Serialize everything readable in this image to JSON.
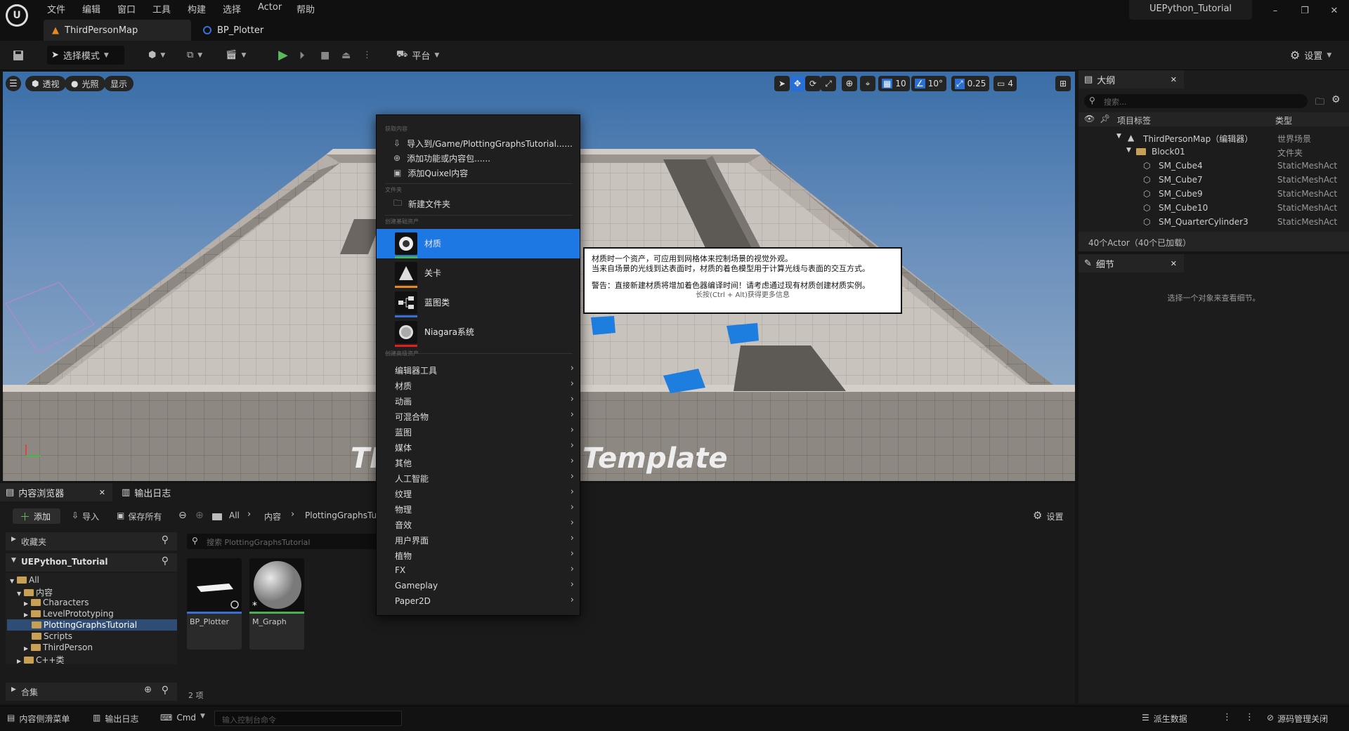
{
  "menubar": {
    "items": [
      "文件",
      "编辑",
      "窗口",
      "工具",
      "构建",
      "选择",
      "Actor",
      "帮助"
    ],
    "project_name": "UEPython_Tutorial"
  },
  "doc_tabs": [
    {
      "label": "ThirdPersonMap",
      "icon": "level-icon"
    },
    {
      "label": "BP_Plotter",
      "icon": "blueprint-icon"
    }
  ],
  "toolbar": {
    "select_mode": "选择模式",
    "platform": "平台",
    "settings": "设置"
  },
  "viewport": {
    "perspective": "透视",
    "lit": "光照",
    "show": "显示",
    "grid_snap": "10",
    "rot_snap": "10°",
    "scale_snap": "0.25",
    "camera_speed": "4",
    "template_text": "Template",
    "template_text_partial": "TI"
  },
  "context_menu": {
    "sections": {
      "get_content": "获取内容",
      "folder": "文件夹",
      "basic_assets": "创建基础资产",
      "advanced_assets": "创建高级资产"
    },
    "get_content_items": [
      "导入到/Game/PlottingGraphsTutorial......",
      "添加功能或内容包......",
      "添加Quixel内容"
    ],
    "folder_items": [
      "新建文件夹"
    ],
    "basic_assets": [
      {
        "label": "材质",
        "color": "#4caf50",
        "highlighted": true
      },
      {
        "label": "关卡",
        "color": "#e8891f",
        "highlighted": false
      },
      {
        "label": "蓝图类",
        "color": "#3a6fd8",
        "highlighted": false
      },
      {
        "label": "Niagara系统",
        "color": "#e02020",
        "highlighted": false
      }
    ],
    "advanced_assets": [
      "编辑器工具",
      "材质",
      "动画",
      "可混合物",
      "蓝图",
      "媒体",
      "其他",
      "人工智能",
      "纹理",
      "物理",
      "音效",
      "用户界面",
      "植物",
      "FX",
      "Gameplay",
      "Paper2D"
    ]
  },
  "tooltip": {
    "line1": "材质时一个资产，可应用到网格体来控制场景的视觉外观。",
    "line2": "当来自场景的光线到达表面时，材质的着色模型用于计算光线与表面的交互方式。",
    "line3": "警告：直接新建材质将增加着色器编译时间！请考虑通过现有材质创建材质实例。",
    "hint": "长按(Ctrl + Alt)获得更多信息"
  },
  "outliner": {
    "title": "大纲",
    "search_placeholder": "搜索...",
    "col_label": "项目标签",
    "col_type": "类型",
    "rows": [
      {
        "label": "ThirdPersonMap（编辑器）",
        "type": "世界场景"
      },
      {
        "label": "Block01",
        "type": "文件夹"
      },
      {
        "label": "SM_Cube4",
        "type": "StaticMeshAct"
      },
      {
        "label": "SM_Cube7",
        "type": "StaticMeshAct"
      },
      {
        "label": "SM_Cube9",
        "type": "StaticMeshAct"
      },
      {
        "label": "SM_Cube10",
        "type": "StaticMeshAct"
      },
      {
        "label": "SM_QuarterCylinder3",
        "type": "StaticMeshAct"
      }
    ],
    "count": "40个Actor（40个已加载）"
  },
  "details": {
    "title": "细节",
    "empty": "选择一个对象来查看细节。"
  },
  "content_browser": {
    "tab": "内容浏览器",
    "log_tab": "输出日志",
    "add": "添加",
    "import": "导入",
    "save_all": "保存所有",
    "path": [
      "All",
      "内容",
      "PlottingGraphsTu"
    ],
    "settings": "设置",
    "favorites": "收藏夹",
    "project": "UEPython_Tutorial",
    "search_placeholder": "搜索 PlottingGraphsTutorial",
    "tree": [
      {
        "label": "All",
        "depth": 0
      },
      {
        "label": "内容",
        "depth": 1
      },
      {
        "label": "Characters",
        "depth": 2
      },
      {
        "label": "LevelPrototyping",
        "depth": 2
      },
      {
        "label": "PlottingGraphsTutorial",
        "depth": 2
      },
      {
        "label": "Scripts",
        "depth": 2
      },
      {
        "label": "ThirdPerson",
        "depth": 2
      },
      {
        "label": "C++类",
        "depth": 1
      }
    ],
    "collections": "合集",
    "assets": [
      {
        "name": "BP_Plotter",
        "bar": "#3a6fd8"
      },
      {
        "name": "M_Graph",
        "bar": "#4caf50"
      }
    ],
    "item_count": "2 项"
  },
  "statusbar": {
    "drawer": "内容侧滑菜单",
    "log": "输出日志",
    "cmd": "Cmd",
    "console_placeholder": "输入控制台命令",
    "source_control": "派生数据",
    "revision": "源码管理关闭"
  }
}
